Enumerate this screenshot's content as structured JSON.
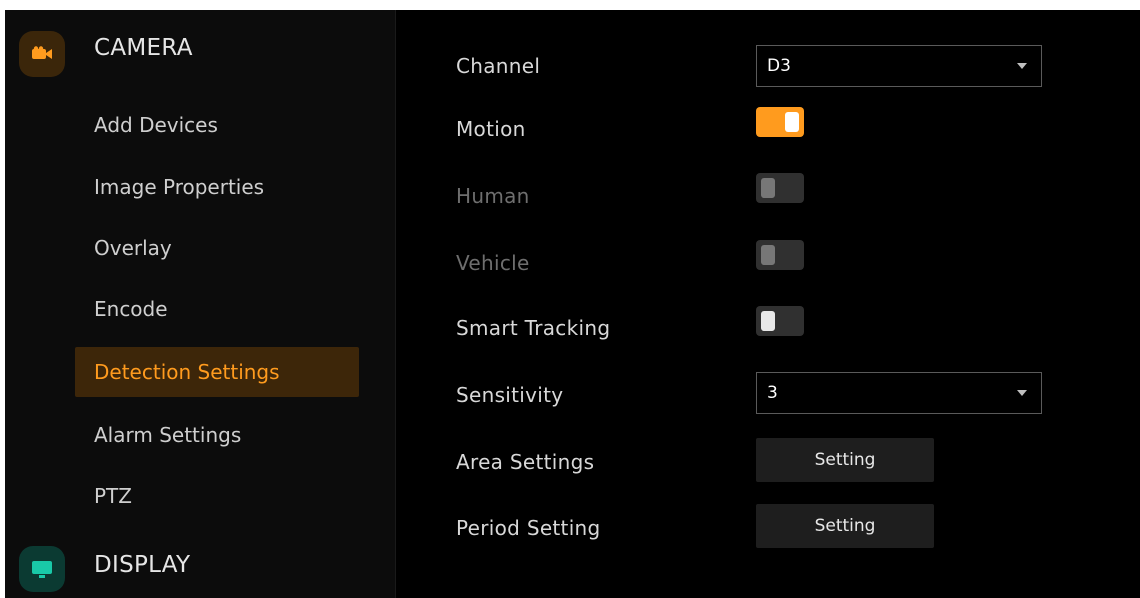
{
  "sidebar": {
    "camera": {
      "title": "CAMERA",
      "icon": "video-camera-icon",
      "icon_color": "#ff9b1e"
    },
    "items": [
      {
        "label": "Add Devices"
      },
      {
        "label": "Image Properties"
      },
      {
        "label": "Overlay"
      },
      {
        "label": "Encode"
      },
      {
        "label": "Detection Settings",
        "active": true
      },
      {
        "label": "Alarm Settings"
      },
      {
        "label": "PTZ"
      }
    ],
    "display": {
      "title": "DISPLAY",
      "icon": "monitor-icon",
      "icon_color": "#19c9a8"
    }
  },
  "settings": {
    "channel": {
      "label": "Channel",
      "value": "D3"
    },
    "motion": {
      "label": "Motion",
      "enabled": true
    },
    "human": {
      "label": "Human",
      "enabled": false
    },
    "vehicle": {
      "label": "Vehicle",
      "enabled": false
    },
    "smart_tracking": {
      "label": "Smart Tracking",
      "enabled": false
    },
    "sensitivity": {
      "label": "Sensitivity",
      "value": "3"
    },
    "area_settings": {
      "label": "Area Settings",
      "button": "Setting"
    },
    "period_setting": {
      "label": "Period Setting",
      "button": "Setting"
    }
  },
  "colors": {
    "accent": "#ff9b1e",
    "active_bg": "#3d2609",
    "display_accent": "#19c9a8"
  }
}
